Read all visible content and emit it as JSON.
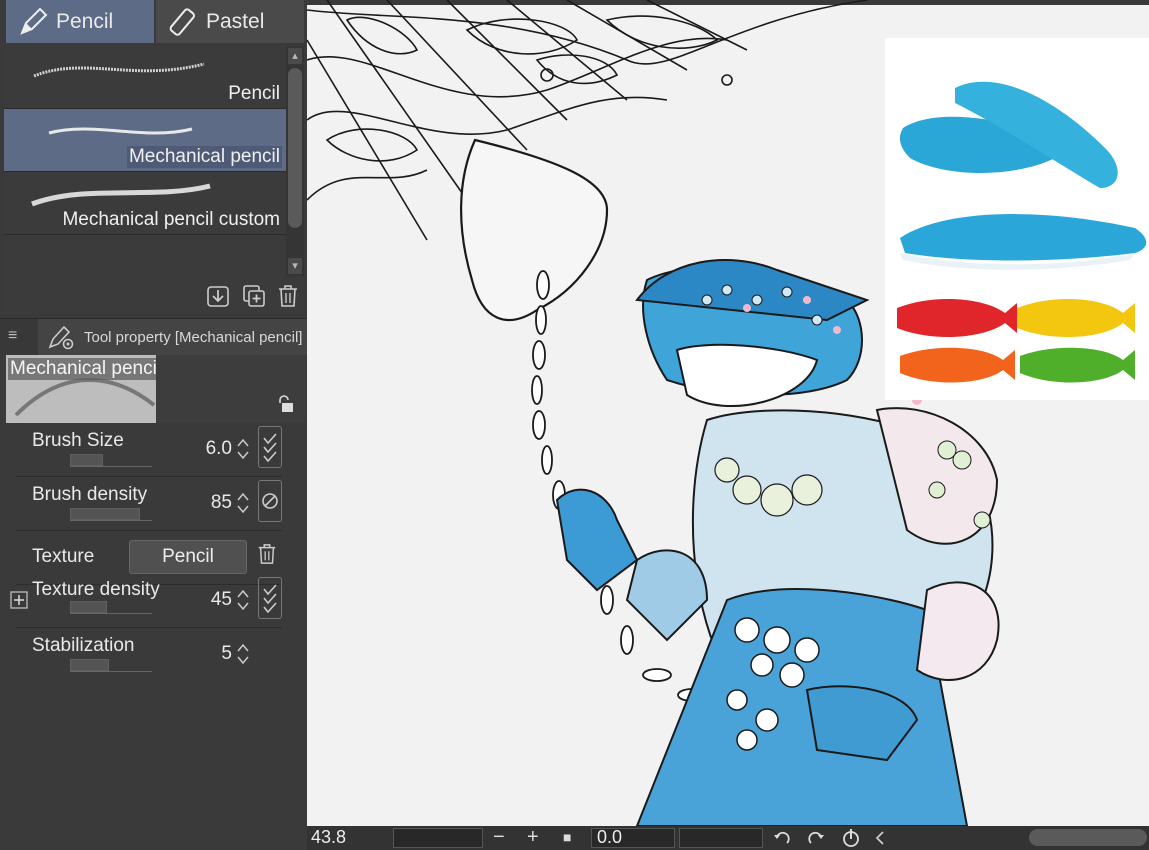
{
  "tabs": [
    {
      "label": "Pencil",
      "icon": "pencil-icon",
      "selected": true
    },
    {
      "label": "Pastel",
      "icon": "pastel-icon",
      "selected": false
    }
  ],
  "brushes": [
    {
      "label": "Pencil",
      "selected": false
    },
    {
      "label": "Mechanical pencil",
      "selected": true
    },
    {
      "label": "Mechanical pencil custom",
      "selected": false
    }
  ],
  "list_toolbar": {
    "icons": [
      "import-icon",
      "duplicate-icon",
      "trash-icon"
    ]
  },
  "tool_property": {
    "menu_glyph": "≡",
    "title": "Tool property [Mechanical pencil]",
    "preset_name": "Mechanical pencil"
  },
  "properties": [
    {
      "label": "Brush Size",
      "value": "6.0",
      "level": 0.4,
      "button": "pressure-check-icon"
    },
    {
      "label": "Brush density",
      "value": "85",
      "level": 0.85,
      "button": "no-pressure-icon"
    },
    {
      "label": "Texture",
      "button_label": "Pencil"
    },
    {
      "label": "Texture density",
      "value": "45",
      "level": 0.45,
      "button": "pressure-check-icon"
    },
    {
      "label": "Stabilization",
      "value": "5",
      "level": 0.5
    }
  ],
  "statusbar": {
    "zoom": "43.8",
    "minus": "−",
    "plus": "+",
    "rotation": "0.0"
  },
  "colors": {
    "accent": "#5e6b86",
    "panel": "#3a3a3a",
    "canvas": "#f2f2f2",
    "whale_blue": "#3fa4d8",
    "candy_blue": "#2aa7d6",
    "candy_red": "#e0262b",
    "candy_yellow": "#f3c60f",
    "candy_orange": "#f2641b",
    "candy_green": "#4fae2a"
  }
}
